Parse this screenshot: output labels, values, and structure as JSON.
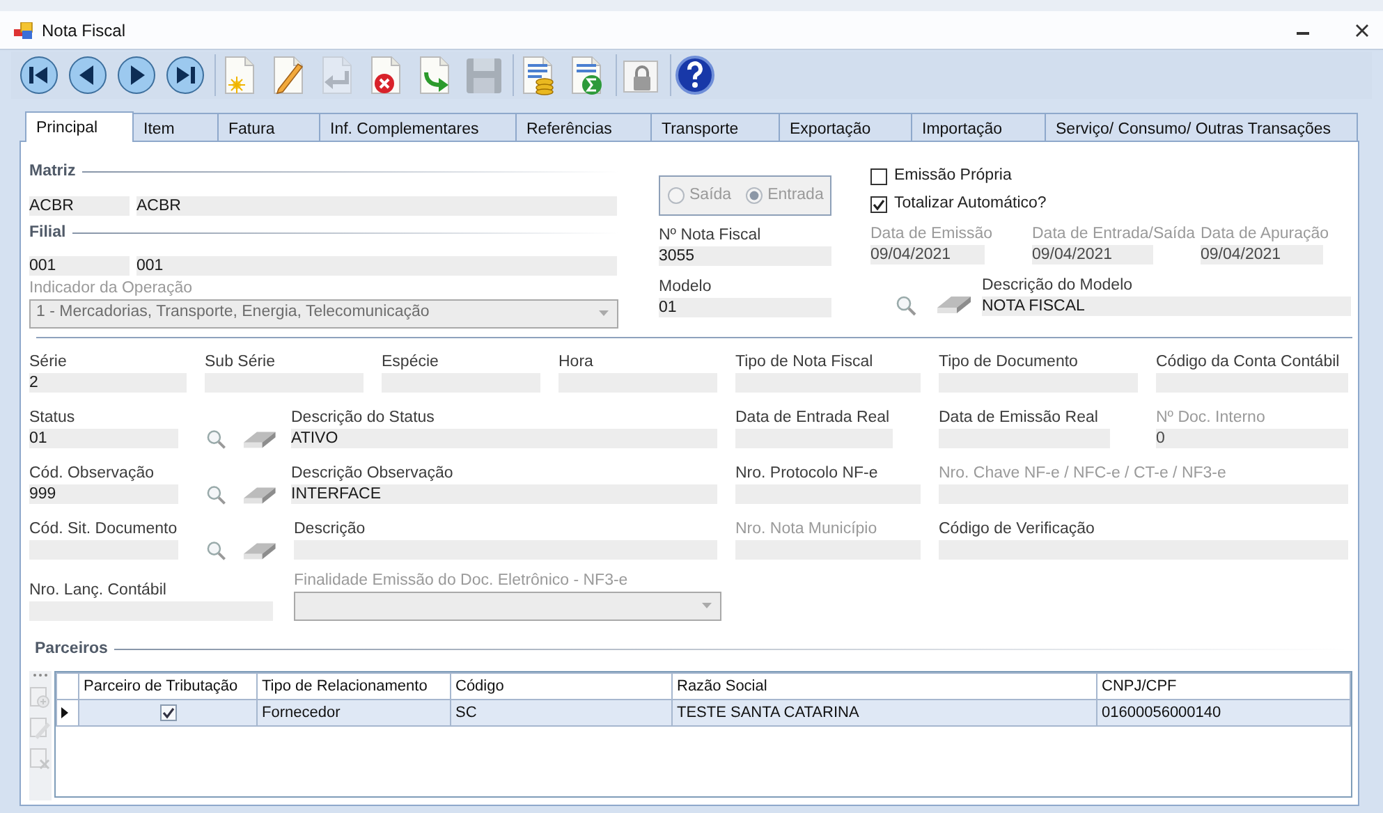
{
  "window": {
    "title": "Nota Fiscal"
  },
  "toolbar": [
    [
      {
        "kind": "first",
        "disabled": false
      },
      {
        "kind": "prev",
        "disabled": false
      },
      {
        "kind": "next",
        "disabled": false
      },
      {
        "kind": "last",
        "disabled": false
      }
    ],
    [
      {
        "kind": "new",
        "disabled": false
      },
      {
        "kind": "edit",
        "disabled": false
      },
      {
        "kind": "undo",
        "disabled": true
      },
      {
        "kind": "delete",
        "disabled": false
      },
      {
        "kind": "confirm",
        "disabled": false
      },
      {
        "kind": "save",
        "disabled": true
      }
    ],
    [
      {
        "kind": "report",
        "disabled": false
      },
      {
        "kind": "sum",
        "disabled": false
      }
    ],
    [
      {
        "kind": "lock",
        "disabled": false
      }
    ],
    [
      {
        "kind": "help",
        "disabled": false
      }
    ]
  ],
  "tabs": [
    {
      "label": "Principal",
      "selected": true
    },
    {
      "label": "Item",
      "selected": false
    },
    {
      "label": "Fatura",
      "selected": false
    },
    {
      "label": "Inf. Complementares",
      "selected": false
    },
    {
      "label": "Referências",
      "selected": false
    },
    {
      "label": "Transporte",
      "selected": false
    },
    {
      "label": "Exportação",
      "selected": false
    },
    {
      "label": "Importação",
      "selected": false
    },
    {
      "label": "Serviço/ Consumo/ Outras Transações",
      "selected": false
    }
  ],
  "matriz": {
    "title": "Matriz",
    "code": "ACBR",
    "name": "ACBR"
  },
  "filial": {
    "title": "Filial",
    "code": "001",
    "name": "001"
  },
  "operation": {
    "label": "Indicador da Operação",
    "value": "1 - Mercadorias, Transporte, Energia, Telecomunicação",
    "disabled": true
  },
  "direction": {
    "disabled": true,
    "options": [
      {
        "label": "Saída",
        "selected": false
      },
      {
        "label": "Entrada",
        "selected": true
      }
    ]
  },
  "invoice_number": {
    "label": "Nº Nota Fiscal",
    "value": "3055",
    "disabled": false
  },
  "model": {
    "label": "Modelo",
    "value": "01",
    "disabled": false
  },
  "options": [
    {
      "label": "Emissão Própria",
      "checked": false
    },
    {
      "label": "Totalizar Automático?",
      "checked": true
    }
  ],
  "dates": [
    {
      "label": "Data de Emissão",
      "value": "09/04/2021",
      "disabled": true
    },
    {
      "label": "Data de Entrada/Saída",
      "value": "09/04/2021",
      "disabled": true
    },
    {
      "label": "Data de Apuração",
      "value": "09/04/2021",
      "disabled": true
    }
  ],
  "model_description": {
    "label": "Descrição do Modelo",
    "value": "NOTA FISCAL",
    "disabled": false
  },
  "form_rows": [
    [
      {
        "kind": "field",
        "label": "Série",
        "value": "2",
        "disabled": false
      },
      {
        "kind": "field",
        "label": "Sub Série",
        "disabled": false
      },
      {
        "kind": "field",
        "label": "Espécie",
        "disabled": false
      },
      {
        "kind": "field",
        "label": "Hora",
        "disabled": false
      },
      {
        "kind": "field",
        "label": "Tipo de Nota Fiscal",
        "disabled": false
      },
      {
        "kind": "field",
        "label": "Tipo de Documento",
        "disabled": false
      },
      {
        "kind": "field",
        "label": "Código da Conta Contábil",
        "disabled": false
      }
    ],
    [
      {
        "kind": "field",
        "label": "Status",
        "value": "01",
        "disabled": false
      },
      {
        "kind": "lookup"
      },
      {
        "kind": "field",
        "label": "Descrição do Status",
        "value": "ATIVO",
        "disabled": false
      },
      {
        "kind": "field",
        "label": "Data de Entrada Real",
        "disabled": false
      },
      {
        "kind": "field",
        "label": "Data de Emissão Real",
        "disabled": false
      },
      {
        "kind": "field",
        "label": "Nº Doc. Interno",
        "value": "0",
        "disabled": true
      }
    ],
    [
      {
        "kind": "field",
        "label": "Cód. Observação",
        "value": "999",
        "disabled": false
      },
      {
        "kind": "lookup"
      },
      {
        "kind": "field",
        "label": "Descrição Observação",
        "value": "INTERFACE",
        "disabled": false
      },
      {
        "kind": "field",
        "label": "Nro. Protocolo NF-e",
        "disabled": false
      },
      {
        "kind": "field",
        "label": "Nro. Chave NF-e / NFC-e / CT-e / NF3-e",
        "disabled": true
      }
    ],
    [
      {
        "kind": "field",
        "label": "Cód. Sit. Documento",
        "disabled": false
      },
      {
        "kind": "lookup"
      },
      {
        "kind": "field",
        "label": "Descrição",
        "disabled": false
      },
      {
        "kind": "field",
        "label": "Nro. Nota Município",
        "disabled": true
      },
      {
        "kind": "field",
        "label": "Código de Verificação",
        "disabled": false
      }
    ],
    [
      {
        "kind": "field",
        "label": "Nro. Lanç. Contábil",
        "disabled": false
      },
      {
        "kind": "combo",
        "label": "Finalidade Emissão do Doc. Eletrônico - NF3-e",
        "disabled": true
      }
    ]
  ],
  "partners": {
    "title": "Parceiros",
    "side_tools": [
      {
        "kind": "add",
        "disabled": true
      },
      {
        "kind": "edit",
        "disabled": true
      },
      {
        "kind": "delete",
        "disabled": true
      }
    ],
    "columns": [
      "Parceiro de Tributação",
      "Tipo de Relacionamento",
      "Código",
      "Razão Social",
      "CNPJ/CPF"
    ],
    "rows": [
      {
        "selected": true,
        "cells": [
          {
            "kind": "check",
            "checked": true
          },
          {
            "kind": "text",
            "text": "Fornecedor"
          },
          {
            "kind": "text",
            "text": "SC"
          },
          {
            "kind": "text",
            "text": "TESTE SANTA CATARINA"
          },
          {
            "kind": "text",
            "text": "01600056000140"
          }
        ]
      }
    ]
  }
}
